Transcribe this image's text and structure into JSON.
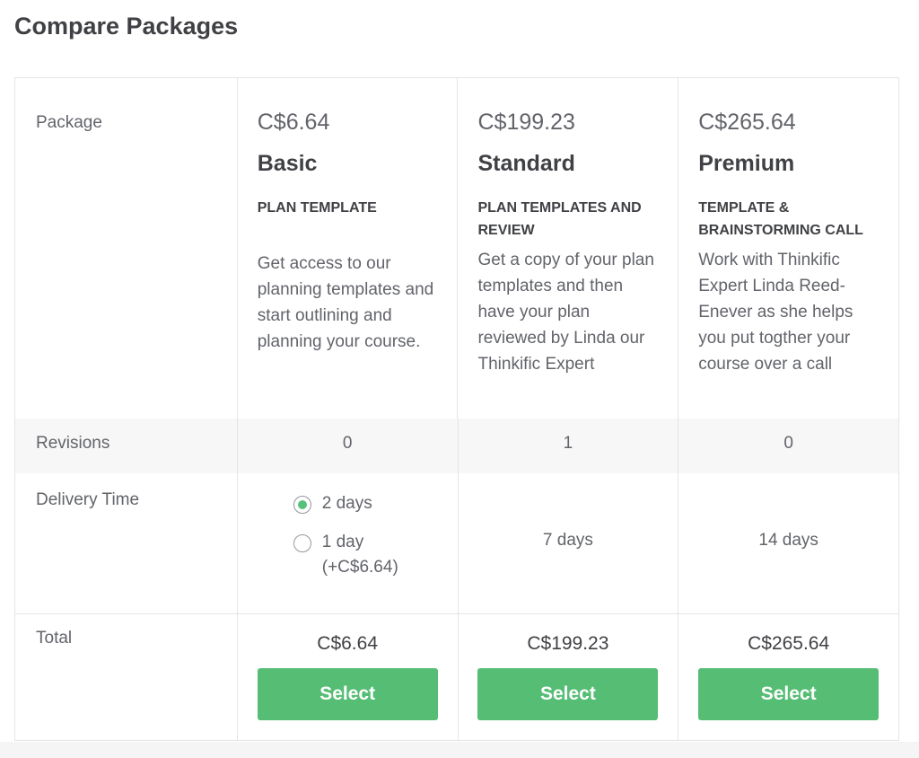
{
  "title": "Compare Packages",
  "row_labels": {
    "package": "Package",
    "revisions": "Revisions",
    "delivery": "Delivery Time",
    "total": "Total"
  },
  "packages": [
    {
      "price": "C$6.64",
      "name": "Basic",
      "subtitle": "PLAN TEMPLATE",
      "description": "Get access to our planning templates and start outlining and planning your course.",
      "revisions": "0",
      "delivery_options": [
        {
          "label": "2 days",
          "selected": true
        },
        {
          "label": "1 day",
          "extra": "(+C$6.64)",
          "selected": false
        }
      ],
      "total": "C$6.64",
      "button": "Select"
    },
    {
      "price": "C$199.23",
      "name": "Standard",
      "subtitle": "PLAN TEMPLATES AND REVIEW",
      "description": "Get a copy of your plan templates and then have your plan reviewed by Linda our Thinkific Expert",
      "revisions": "1",
      "delivery": "7 days",
      "total": "C$199.23",
      "button": "Select"
    },
    {
      "price": "C$265.64",
      "name": "Premium",
      "subtitle": "TEMPLATE & BRAINSTORMING CALL",
      "description": "Work with Thinkific Expert Linda Reed-Enever as she helps you put togther your course over a call",
      "revisions": "0",
      "delivery": "14 days",
      "total": "C$265.64",
      "button": "Select"
    }
  ],
  "colors": {
    "accent": "#55bd74",
    "text_dark": "#404145",
    "text_muted": "#62646a",
    "border": "#e4e5e7",
    "row_highlight": "#f7f7f7"
  }
}
